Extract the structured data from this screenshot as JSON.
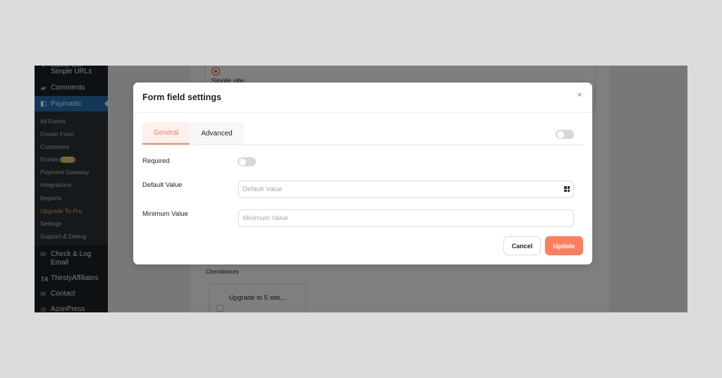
{
  "sidebar": {
    "items_top": [
      {
        "label": "Simple URLs",
        "icon": "pin-icon"
      },
      {
        "label": "Comments",
        "icon": "comment-icon"
      },
      {
        "label": "Paymattic",
        "icon": "paymattic-icon"
      }
    ],
    "submenu": [
      {
        "label": "All Forms"
      },
      {
        "label": "Create Form"
      },
      {
        "label": "Customers"
      },
      {
        "label": "Entries",
        "badge": "159"
      },
      {
        "label": "Payment Gateway"
      },
      {
        "label": "Integrations"
      },
      {
        "label": "Reports"
      },
      {
        "label": "Upgrade To Pro"
      },
      {
        "label": "Settings"
      },
      {
        "label": "Support & Debug"
      }
    ],
    "items_bottom": [
      {
        "label_line1": "Check & Log",
        "label_line2": "Email",
        "icon": "mail-icon"
      },
      {
        "label": "ThirstyAffiliates",
        "icon": "ta-logo-icon",
        "icon_text": "TA"
      },
      {
        "label": "Contact",
        "icon": "envelope-icon"
      },
      {
        "label": "AzonPress",
        "icon": "link-icon"
      }
    ]
  },
  "background": {
    "radio_label": "Single site",
    "checkboxes_label": "Checkboxes",
    "checkbox_option": "Upgrade to 5 site..."
  },
  "modal": {
    "title": "Form field settings",
    "close_icon": "×",
    "tabs": [
      {
        "label": "General",
        "active": true
      },
      {
        "label": "Advanced",
        "active": false
      }
    ],
    "fields": {
      "required_label": "Required",
      "required_value": false,
      "default_label": "Default Value",
      "default_placeholder": "Default Value",
      "minimum_label": "Minimum Value",
      "minimum_placeholder": "Minimum Value"
    },
    "header_toggle_value": false,
    "cancel_label": "Cancel",
    "update_label": "Update"
  },
  "colors": {
    "accent": "#ff7f5c",
    "wp_blue": "#2271b1",
    "close": "#7b61ff",
    "badge": "#f0b849"
  }
}
